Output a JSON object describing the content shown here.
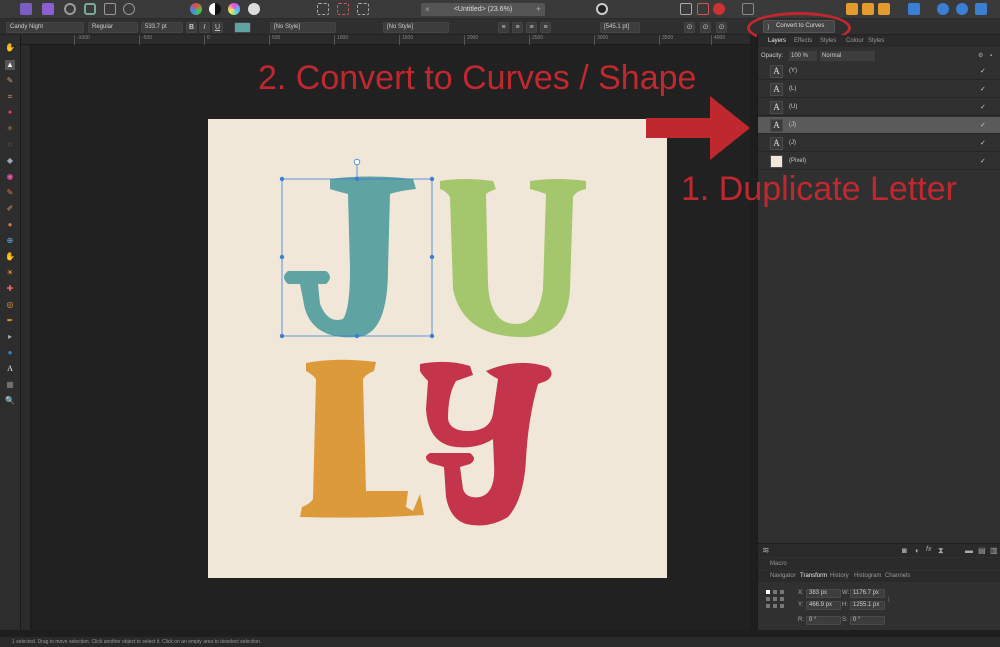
{
  "toolbar": {
    "document_tab": "<Untitled> (23.6%)",
    "tab_close": "×",
    "tab_add": "+"
  },
  "context_bar": {
    "font_family": "Candy Night",
    "font_style": "Regular",
    "font_size": "533.7 pt",
    "bold": "B",
    "italic": "I",
    "underline": "U",
    "text_color": "#5fa3a3",
    "paragraph_style": "[No Style]",
    "character_style": "[No Style]",
    "leading": "[545.1 pt]",
    "convert_label": "Convert to Curves",
    "convert_icon": "convert-icon"
  },
  "ruler": {
    "ticks": [
      "-1000",
      "-500",
      "0",
      "500",
      "1000",
      "1500",
      "2000",
      "2500",
      "3000",
      "3500",
      "4000"
    ]
  },
  "layers": {
    "tabs": [
      "Layers",
      "Effects",
      "Styles",
      "Colour",
      "Styles"
    ],
    "opacity_label": "Opacity:",
    "opacity_value": "100 %",
    "blend_mode": "Normal",
    "items": [
      {
        "name": "(Y)",
        "icon": "A",
        "selected": false
      },
      {
        "name": "(L)",
        "icon": "A",
        "selected": false
      },
      {
        "name": "(U)",
        "icon": "A",
        "selected": false
      },
      {
        "name": "(J)",
        "icon": "A",
        "selected": true
      },
      {
        "name": "(J)",
        "icon": "A",
        "selected": false
      },
      {
        "name": "(Pixel)",
        "icon": "",
        "selected": false
      }
    ],
    "check": "✓"
  },
  "macro_label": "Macro",
  "transform_tabs": [
    "Navigator",
    "Transform",
    "History",
    "Histogram",
    "Channels"
  ],
  "transform": {
    "x_label": "X:",
    "x": "383 px",
    "y_label": "Y:",
    "y": "466.9 px",
    "w_label": "W:",
    "w": "1176.7 px",
    "h_label": "H:",
    "h": "1255.1 px",
    "r_label": "R:",
    "r": "0 °",
    "s_label": "S:",
    "s": "0 °"
  },
  "status": "1 selected. Drag to move selection. Click another object to select it. Click on an empty area to deselect selection.",
  "annotations": {
    "step2": "2. Convert to Curves / Shape",
    "step1": "1. Duplicate Letter",
    "color": "#c0282f"
  },
  "letters": [
    {
      "char": "J",
      "color": "#5fa3a3"
    },
    {
      "char": "U",
      "color": "#a4c76d"
    },
    {
      "char": "L",
      "color": "#dd9a3a"
    },
    {
      "char": "Y",
      "color": "#c4344a"
    }
  ]
}
